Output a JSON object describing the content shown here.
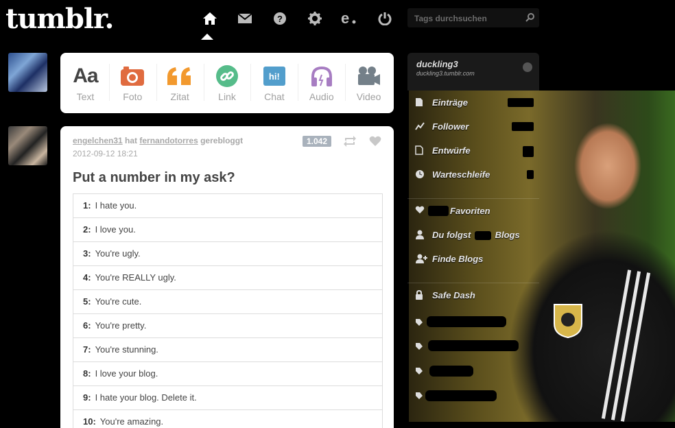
{
  "logo": "tumblr.",
  "nav": {
    "icons": [
      "home-icon",
      "mail-icon",
      "help-icon",
      "gear-icon",
      "explore-icon",
      "power-icon"
    ],
    "active": "home"
  },
  "search": {
    "placeholder": "Tags durchsuchen"
  },
  "post_types": [
    {
      "key": "text",
      "glyph": "Aa",
      "label": "Text",
      "color": "#444444"
    },
    {
      "key": "photo",
      "label": "Foto",
      "color": "#e06b3f"
    },
    {
      "key": "quote",
      "label": "Zitat",
      "color": "#f2992e"
    },
    {
      "key": "link",
      "label": "Link",
      "color": "#56bc8a"
    },
    {
      "key": "chat",
      "glyph": "hi!",
      "label": "Chat",
      "color": "#529ecc"
    },
    {
      "key": "audio",
      "label": "Audio",
      "color": "#a77dc2"
    },
    {
      "key": "video",
      "label": "Video",
      "color": "#748089"
    }
  ],
  "post": {
    "reblogger": "engelchen31",
    "hat": "hat",
    "source": "fernandotorres",
    "action": "gerebloggt",
    "date": "2012-09-12 18:21",
    "notes": "1.042",
    "title": "Put a number in my ask?",
    "answers": [
      {
        "num": "1:",
        "text": "I hate you."
      },
      {
        "num": "2:",
        "text": "I love you."
      },
      {
        "num": "3:",
        "text": "You're ugly."
      },
      {
        "num": "4:",
        "text": "You're REALLY ugly."
      },
      {
        "num": "5:",
        "text": "You're cute."
      },
      {
        "num": "6:",
        "text": "You're pretty."
      },
      {
        "num": "7:",
        "text": "You're stunning."
      },
      {
        "num": "8:",
        "text": "I love your blog."
      },
      {
        "num": "9:",
        "text": "I hate your blog. Delete it."
      },
      {
        "num": "10:",
        "text": "You're amazing."
      }
    ]
  },
  "sidebar": {
    "blog_name": "duckling3",
    "blog_url": "duckling3.tumblr.com",
    "items": [
      {
        "label": "Einträge",
        "icon": "document-icon"
      },
      {
        "label": "Follower",
        "icon": "chart-icon"
      },
      {
        "label": "Entwürfe",
        "icon": "draft-icon"
      },
      {
        "label": "Warteschleife",
        "icon": "clock-icon"
      },
      {
        "label": "Favoriten",
        "icon": "heart-icon"
      },
      {
        "label": "Du folgst",
        "suffix": "Blogs",
        "icon": "user-icon"
      },
      {
        "label": "Finde Blogs",
        "icon": "add-user-icon"
      },
      {
        "label": "Safe Dash",
        "icon": "lock-icon"
      }
    ]
  }
}
